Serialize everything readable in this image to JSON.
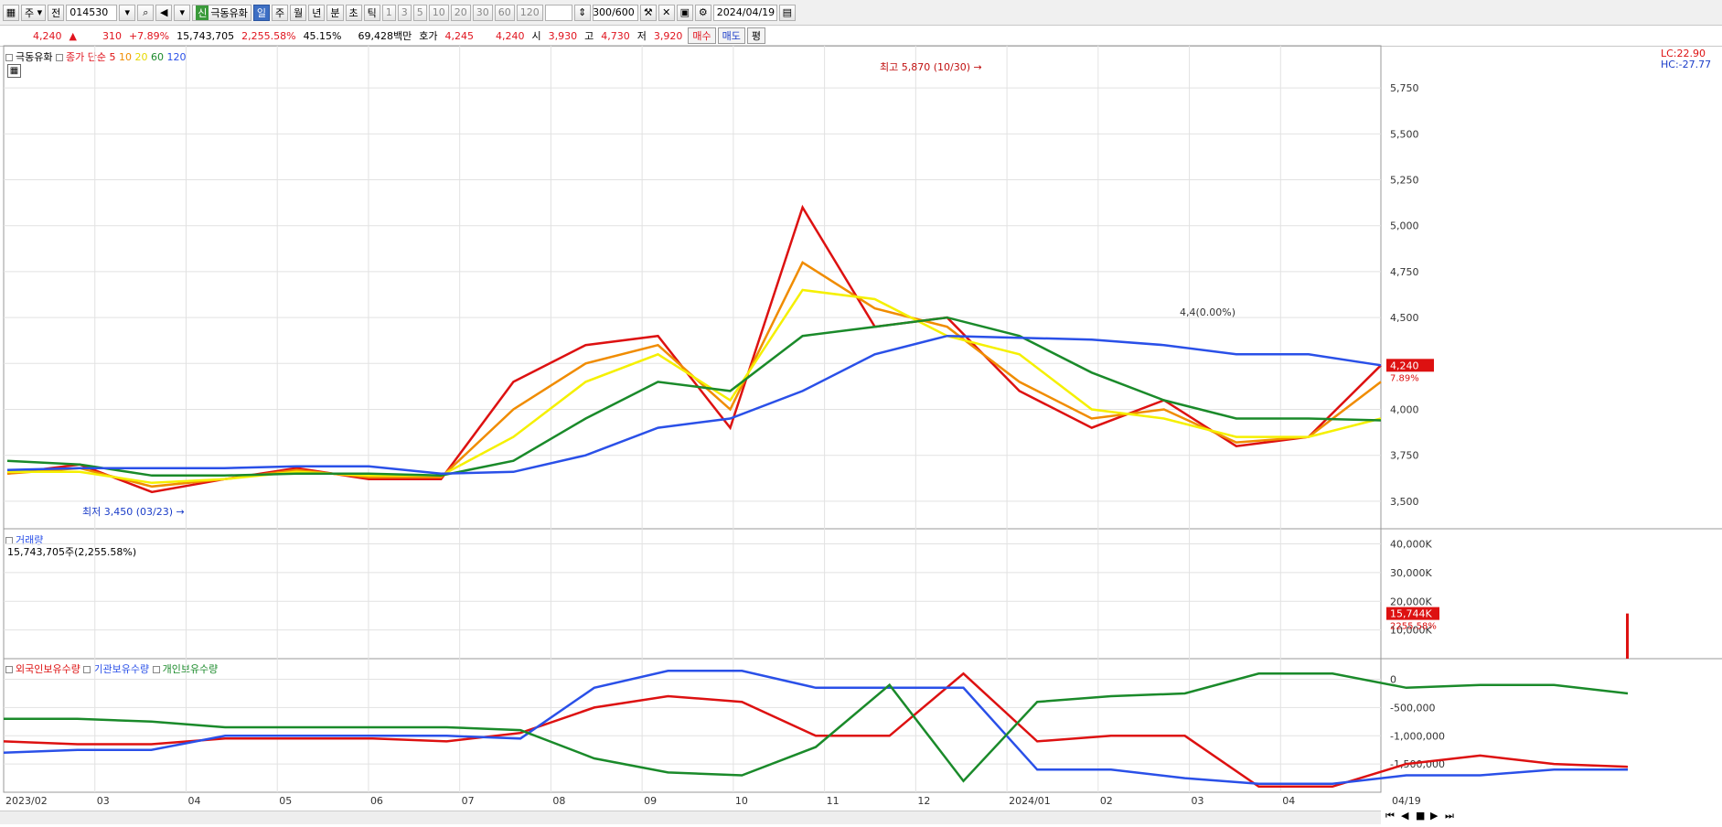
{
  "toolbar": {
    "market": "주",
    "type": "전",
    "code": "014530",
    "badge": "신",
    "name": "극동유화",
    "periods": [
      "일",
      "주",
      "월",
      "년",
      "분",
      "초",
      "틱"
    ],
    "intervals": [
      "1",
      "3",
      "5",
      "10",
      "20",
      "30",
      "60",
      "120"
    ],
    "count": "300",
    "total": "/600",
    "date": "2024/04/19"
  },
  "quote": {
    "price": "4,240",
    "change": "310",
    "pct": "+7.89%",
    "volume": "15,743,705",
    "vol_pct": "2,255.58%",
    "ratio": "45.15%",
    "amount": "69,428백만",
    "bid_label": "호가",
    "bid": "4,245",
    "ask": "4,240",
    "open_label": "시",
    "open": "3,930",
    "high_label": "고",
    "high": "4,730",
    "low_label": "저",
    "low": "3,920",
    "buy": "매수",
    "sell": "매도",
    "avg": "평"
  },
  "price_panel": {
    "name": "극동유화",
    "ma_label": "종가 단순",
    "ma_periods": [
      "5",
      "10",
      "20",
      "60",
      "120"
    ],
    "ma_colors": [
      "#dd1111",
      "#f08c00",
      "#f5f000",
      "#1a8a2a",
      "#2a50e8"
    ],
    "lc": "LC:22.90",
    "hc": "HC:-27.77",
    "current_tag": "4,240",
    "current_pct": "7.89%",
    "high_annot": "최고 5,870 (10/30)",
    "low_annot": "최저 3,450 (03/23)",
    "mid_annot": "4,4(0.00%)"
  },
  "volume_panel": {
    "title": "거래량",
    "value": "15,743,705주(2,255.58%)",
    "current_tag": "15,744K",
    "current_pct": "2255.58%"
  },
  "holding_panel": {
    "titles": [
      "외국인보유수량",
      "기관보유수량",
      "개인보유수량"
    ],
    "colors": [
      "#dd1111",
      "#2a50e8",
      "#1a8a2a"
    ]
  },
  "x_axis": {
    "ticks": [
      "2023/02",
      "03",
      "04",
      "05",
      "06",
      "07",
      "08",
      "09",
      "10",
      "11",
      "12",
      "2024/01",
      "02",
      "03",
      "04"
    ],
    "end_label": "04/19"
  },
  "chart_data": [
    {
      "type": "line",
      "title": "극동유화",
      "x": [
        "2023/02",
        "03",
        "04",
        "05",
        "06",
        "07",
        "08",
        "09",
        "10",
        "11",
        "12",
        "2024/01",
        "02",
        "03",
        "04",
        "04/19"
      ],
      "ylim": [
        3350,
        5950
      ],
      "yticks": [
        "3,500",
        "3,750",
        "4,000",
        "4,250",
        "4,500",
        "4,750",
        "5,000",
        "5,250",
        "5,500",
        "5,750"
      ],
      "series": [
        {
          "name": "5",
          "values": [
            3650,
            3700,
            3550,
            3620,
            3680,
            3620,
            3620,
            4150,
            4350,
            4400,
            3900,
            5100,
            4450,
            4500,
            4100,
            3900,
            4050,
            3800,
            3850,
            4240
          ]
        },
        {
          "name": "10",
          "values": [
            3650,
            3680,
            3580,
            3620,
            3670,
            3630,
            3630,
            4000,
            4250,
            4350,
            4000,
            4800,
            4550,
            4450,
            4150,
            3950,
            4000,
            3820,
            3850,
            4150
          ]
        },
        {
          "name": "20",
          "values": [
            3660,
            3660,
            3600,
            3620,
            3660,
            3640,
            3640,
            3850,
            4150,
            4300,
            4050,
            4650,
            4600,
            4400,
            4300,
            4000,
            3950,
            3850,
            3850,
            3950
          ]
        },
        {
          "name": "60",
          "values": [
            3720,
            3700,
            3640,
            3640,
            3650,
            3650,
            3640,
            3720,
            3950,
            4150,
            4100,
            4400,
            4450,
            4500,
            4400,
            4200,
            4050,
            3950,
            3950,
            3940
          ]
        },
        {
          "name": "120",
          "values": [
            3670,
            3680,
            3680,
            3680,
            3690,
            3690,
            3650,
            3660,
            3750,
            3900,
            3950,
            4100,
            4300,
            4400,
            4390,
            4380,
            4350,
            4300,
            4300,
            4240
          ]
        }
      ]
    },
    {
      "type": "bar",
      "title": "거래량",
      "ylim": [
        0,
        44000
      ],
      "yticks": [
        "10,000K",
        "20,000K",
        "30,000K",
        "40,000K"
      ],
      "values": [
        15744
      ]
    },
    {
      "type": "line",
      "ylim": [
        -2000000,
        300000
      ],
      "yticks": [
        "0",
        "-500,000",
        "-1,000,000",
        "-1,500,000"
      ],
      "series": [
        {
          "name": "외국인보유수량",
          "values": [
            -1100000,
            -1150000,
            -1150000,
            -1050000,
            -1050000,
            -1050000,
            -1100000,
            -950000,
            -500000,
            -300000,
            -400000,
            -1000000,
            -1000000,
            100000,
            -1100000,
            -1000000,
            -1000000,
            -1900000,
            -1900000,
            -1500000,
            -1350000,
            -1500000,
            -1550000
          ]
        },
        {
          "name": "기관보유수량",
          "values": [
            -1300000,
            -1250000,
            -1250000,
            -1000000,
            -1000000,
            -1000000,
            -1000000,
            -1050000,
            -150000,
            150000,
            150000,
            -150000,
            -150000,
            -150000,
            -1600000,
            -1600000,
            -1750000,
            -1850000,
            -1850000,
            -1700000,
            -1700000,
            -1600000,
            -1600000
          ]
        },
        {
          "name": "개인보유수량",
          "values": [
            -700000,
            -700000,
            -750000,
            -850000,
            -850000,
            -850000,
            -850000,
            -900000,
            -1400000,
            -1650000,
            -1700000,
            -1200000,
            -100000,
            -1800000,
            -400000,
            -300000,
            -250000,
            100000,
            100000,
            -150000,
            -100000,
            -100000,
            -250000
          ]
        }
      ]
    }
  ]
}
